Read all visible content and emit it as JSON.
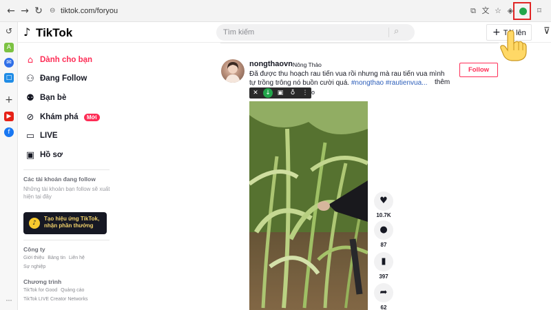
{
  "browser": {
    "url": "tiktok.com/foryou",
    "back_icon": "arrow-left-icon",
    "forward_icon": "arrow-right-icon",
    "reload_icon": "reload-icon"
  },
  "header": {
    "logo_text": "TikTok",
    "search_placeholder": "Tìm kiếm",
    "upload_label": "Tải lên"
  },
  "nav": {
    "items": [
      {
        "label": "Dành cho bạn",
        "icon": "home-icon",
        "active": true
      },
      {
        "label": "Đang Follow",
        "icon": "follow-users-icon",
        "active": false
      },
      {
        "label": "Bạn bè",
        "icon": "friends-icon",
        "active": false
      },
      {
        "label": "Khám phá",
        "icon": "compass-icon",
        "active": false,
        "badge": "Mới"
      },
      {
        "label": "LIVE",
        "icon": "live-icon",
        "active": false
      },
      {
        "label": "Hồ sơ",
        "icon": "profile-icon",
        "active": false
      }
    ],
    "following_title": "Các tài khoản đang follow",
    "following_desc": "Những tài khoản bạn follow sẽ xuất hiện tại đây",
    "effect_cta": "Tạo hiệu ứng TikTok, nhận phần thưởng",
    "company_title": "Công ty",
    "company_links": [
      "Giới thiệu",
      "Bảng tin",
      "Liên hệ"
    ],
    "careers": "Sự nghiệp",
    "program_title": "Chương trình",
    "program_links": [
      "TikTok for Good",
      "Quảng cáo"
    ],
    "program_links_2": [
      "TikTok LIVE Creator Networks"
    ]
  },
  "post": {
    "author": "nongthaovn",
    "nickname": "Nông Thảo",
    "caption": "Đã được thu hoạch rau tiến vua rồi nhưng mà rau tiến vua mình tự trồng trông nó buồn cười quá.",
    "hashtags": [
      "#nongthao",
      "#rautienvua..."
    ],
    "more": "thêm",
    "toolbar_tail": "o",
    "follow_label": "Follow",
    "stats": {
      "likes": "10.7K",
      "comments": "87",
      "saves": "397",
      "shares": "62"
    }
  },
  "colors": {
    "accent": "#fe2c55",
    "highlight_box": "#e02424",
    "extension_green": "#22a64b"
  }
}
